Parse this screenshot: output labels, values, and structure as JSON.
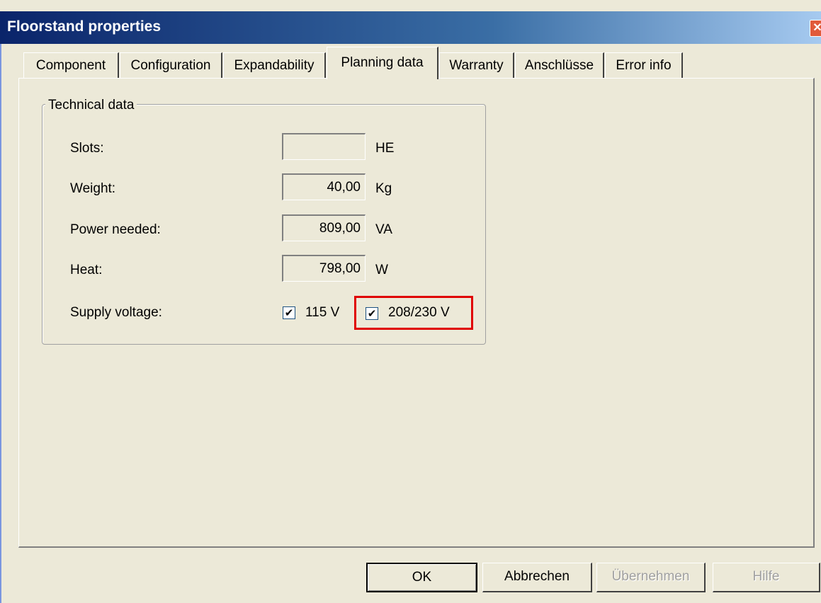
{
  "window": {
    "title": "Floorstand properties",
    "close_glyph": "✕"
  },
  "tabs": [
    {
      "label": "Component"
    },
    {
      "label": "Configuration"
    },
    {
      "label": "Expandability"
    },
    {
      "label": "Planning data",
      "active": true
    },
    {
      "label": "Warranty"
    },
    {
      "label": "Anschlüsse"
    },
    {
      "label": "Error info"
    }
  ],
  "technical_data": {
    "group_title": "Technical data",
    "slots": {
      "label": "Slots:",
      "value": "",
      "unit": "HE"
    },
    "weight": {
      "label": "Weight:",
      "value": "40,00",
      "unit": "Kg"
    },
    "power": {
      "label": "Power needed:",
      "value": "809,00",
      "unit": "VA"
    },
    "heat": {
      "label": "Heat:",
      "value": "798,00",
      "unit": "W"
    },
    "supply": {
      "label": "Supply voltage:",
      "opt1": {
        "label": "115 V",
        "checked": true
      },
      "opt2": {
        "label": "208/230 V",
        "checked": true
      }
    }
  },
  "buttons": {
    "ok": "OK",
    "cancel": "Abbrechen",
    "apply": "Übernehmen",
    "help": "Hilfe"
  },
  "colors": {
    "titlebar": "#0a246a",
    "highlight": "#e00000",
    "dialog_bg": "#ece9d8"
  }
}
